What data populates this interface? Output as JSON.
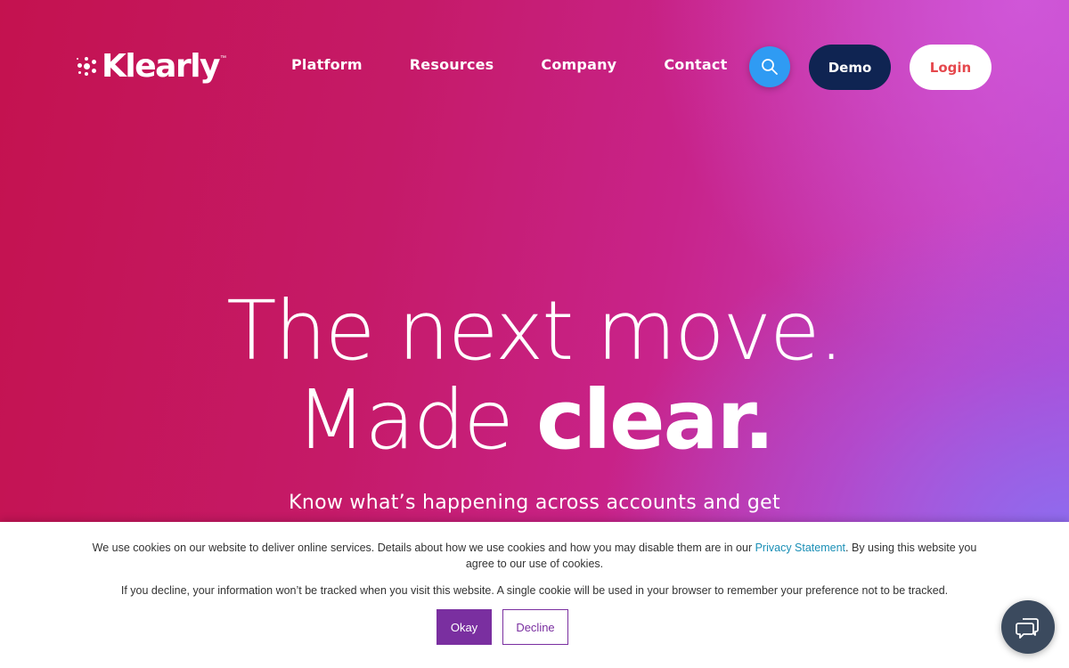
{
  "brand": {
    "name": "Klearly",
    "tm": "™"
  },
  "nav": {
    "items": [
      {
        "label": "Platform"
      },
      {
        "label": "Resources"
      },
      {
        "label": "Company"
      },
      {
        "label": "Contact"
      }
    ]
  },
  "header": {
    "search_icon": "search-icon",
    "demo_label": "Demo",
    "login_label": "Login"
  },
  "hero": {
    "line1": "The next move.",
    "line2_light": "Made ",
    "line2_bold": "clear.",
    "subhead": "Know what’s happening across accounts and get"
  },
  "cookie_banner": {
    "text_before_link": "We use cookies on our website to deliver online services. Details about how we use cookies and how you may disable them are in our ",
    "link_text": "Privacy Statement",
    "text_after_link": ". By using this website you agree to our use of cookies.",
    "second_paragraph": "If you decline, your information won’t be tracked when you visit this website. A single cookie will be used in your browser to remember your preference not to be tracked.",
    "okay_label": "Okay",
    "decline_label": "Decline"
  },
  "chat": {
    "icon": "chat-icon"
  },
  "colors": {
    "accent_blue": "#2f9bf3",
    "demo_navy": "#0f2452",
    "login_red": "#e5484d",
    "cookie_purple": "#7a2fa0",
    "link_teal": "#1a8fb6"
  }
}
